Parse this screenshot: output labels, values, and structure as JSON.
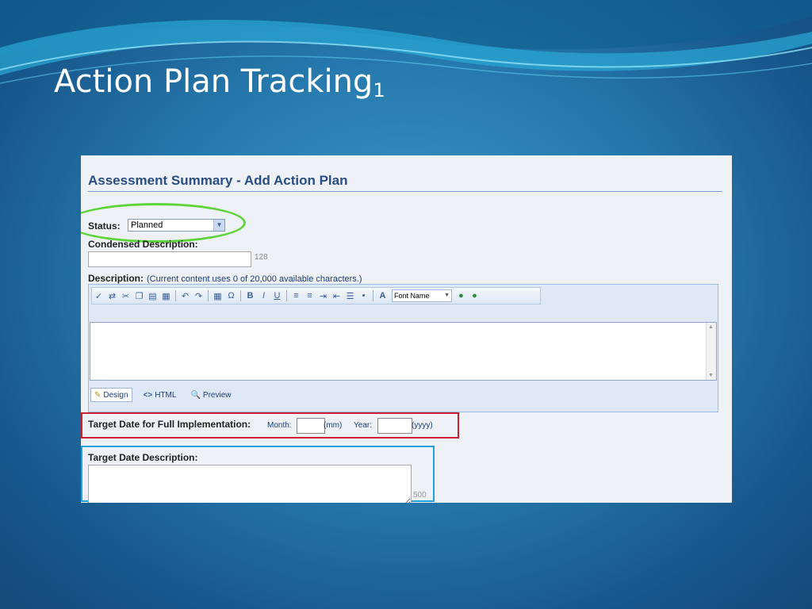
{
  "slide": {
    "title": "Action Plan Tracking",
    "title_subscript": "1"
  },
  "form": {
    "heading": "Assessment Summary - Add Action Plan",
    "status": {
      "label": "Status:",
      "selected": "Planned"
    },
    "condensed": {
      "label": "Condensed Description:",
      "value": "",
      "max_chars": "128"
    },
    "description": {
      "label": "Description:",
      "note": "(Current content uses 0 of 20,000 available characters.)",
      "toolbar": {
        "font_name": "Font Name"
      },
      "modes": [
        {
          "label": "Design"
        },
        {
          "label": "HTML"
        },
        {
          "label": "Preview"
        }
      ]
    },
    "target_date": {
      "label": "Target Date for Full Implementation:",
      "month_label": "Month:",
      "month_hint": "(mm)",
      "year_label": "Year:",
      "year_hint": "(yyyy)"
    },
    "target_desc": {
      "label": "Target Date Description:",
      "max_chars": "500"
    }
  },
  "colors": {
    "heading": "#2a4d86",
    "status_highlight": "#5ed43a",
    "target_date_highlight": "#cc1f2f",
    "target_desc_highlight": "#1fa2dd"
  }
}
